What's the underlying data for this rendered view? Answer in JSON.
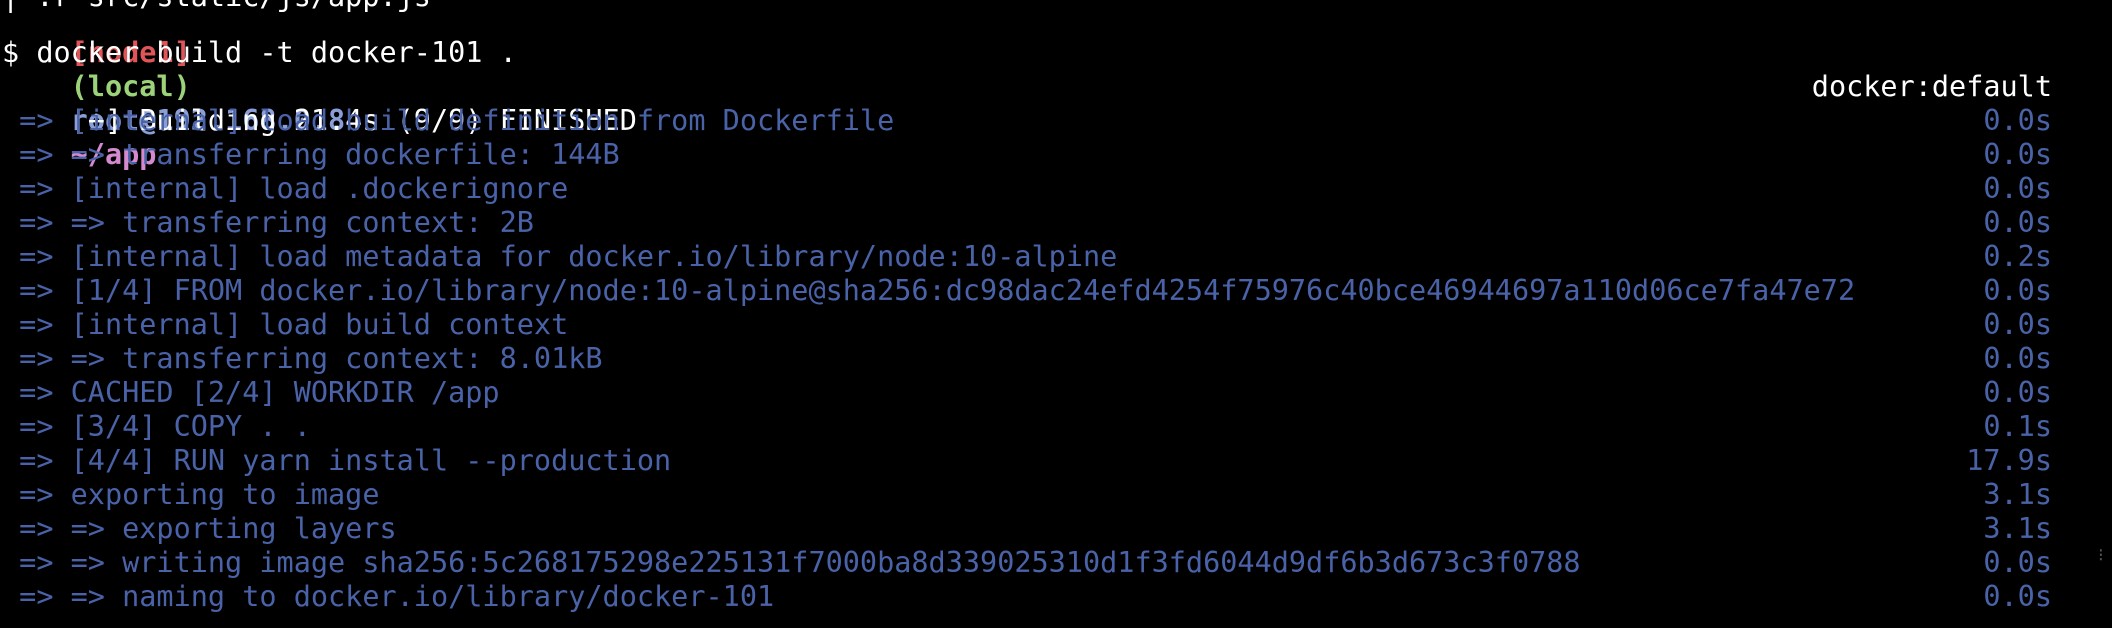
{
  "terminal": {
    "top_fragment": "| .r src/static/js/app.js",
    "prompt": {
      "node": "[node1]",
      "env": "(local)",
      "user_host": "root@192.168.0.8",
      "cwd": "~/app"
    },
    "command": "$ docker build -t docker-101 .",
    "status": {
      "text": "[+] Building 21.4s (9/9) FINISHED",
      "context": "docker:default"
    },
    "steps": [
      {
        "text": " => [internal] load build definition from Dockerfile",
        "time": "0.0s"
      },
      {
        "text": " => => transferring dockerfile: 144B",
        "time": "0.0s"
      },
      {
        "text": " => [internal] load .dockerignore",
        "time": "0.0s"
      },
      {
        "text": " => => transferring context: 2B",
        "time": "0.0s"
      },
      {
        "text": " => [internal] load metadata for docker.io/library/node:10-alpine",
        "time": "0.2s"
      },
      {
        "text": " => [1/4] FROM docker.io/library/node:10-alpine@sha256:dc98dac24efd4254f75976c40bce46944697a110d06ce7fa47e72",
        "time": "0.0s"
      },
      {
        "text": " => [internal] load build context",
        "time": "0.0s"
      },
      {
        "text": " => => transferring context: 8.01kB",
        "time": "0.0s"
      },
      {
        "text": " => CACHED [2/4] WORKDIR /app",
        "time": "0.0s"
      },
      {
        "text": " => [3/4] COPY . .",
        "time": "0.1s"
      },
      {
        "text": " => [4/4] RUN yarn install --production",
        "time": "17.9s"
      },
      {
        "text": " => exporting to image",
        "time": "3.1s"
      },
      {
        "text": " => => exporting layers",
        "time": "3.1s"
      },
      {
        "text": " => => writing image sha256:5c268175298e225131f7000ba8d339025310d1f3fd6044d9df6b3d673c3f0788",
        "time": "0.0s"
      },
      {
        "text": " => => naming to docker.io/library/docker-101",
        "time": "0.0s"
      }
    ]
  },
  "colors": {
    "background": "#000000",
    "step_text": "#4a63a8",
    "node": "#e05658",
    "env": "#9bd27a",
    "user_host": "#8a9ed8",
    "cwd": "#d58ad0"
  }
}
